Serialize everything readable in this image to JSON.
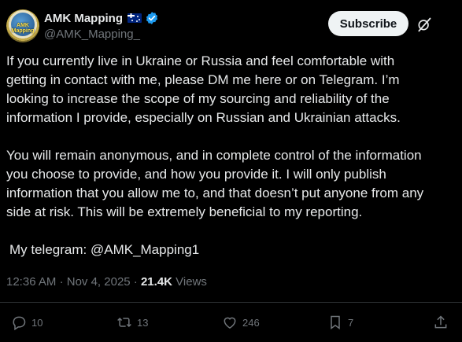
{
  "post": {
    "display_name": "AMK Mapping",
    "handle": "@AMK_Mapping_",
    "avatar_text": "AMK Mapping",
    "subscribe_label": "Subscribe",
    "paragraphs": [
      "If you currently live in Ukraine or Russia and feel comfortable with getting in contact with me, please DM me here or on Telegram. I’m looking to increase the scope of my sourcing and reliability of the information I provide, especially on Russian and Ukrainian attacks.",
      "You will remain anonymous, and in complete control of the information you choose to provide, and how you provide it. I will only publish information that you allow me to, and that doesn’t put anyone from any side at risk. This will be extremely beneficial to my reporting."
    ],
    "telegram_line": "My telegram: @AMK_Mapping1",
    "time": "12:36 AM",
    "separator": "·",
    "date": "Nov 4, 2025",
    "views_count": "21.4K",
    "views_label": "Views"
  },
  "actions": {
    "replies": "10",
    "reposts": "13",
    "likes": "246",
    "bookmarks": "7"
  },
  "icons": {
    "verified": "verified-badge-icon",
    "flag": "australia-flag-icon",
    "more": "grok-icon",
    "reply": "reply-icon",
    "repost": "repost-icon",
    "like": "heart-icon",
    "bookmark": "bookmark-icon",
    "share": "share-icon"
  },
  "colors": {
    "background": "#000000",
    "text": "#e7e9ea",
    "secondary": "#71767b",
    "accent": "#1d9bf0",
    "button_bg": "#eff3f4"
  }
}
